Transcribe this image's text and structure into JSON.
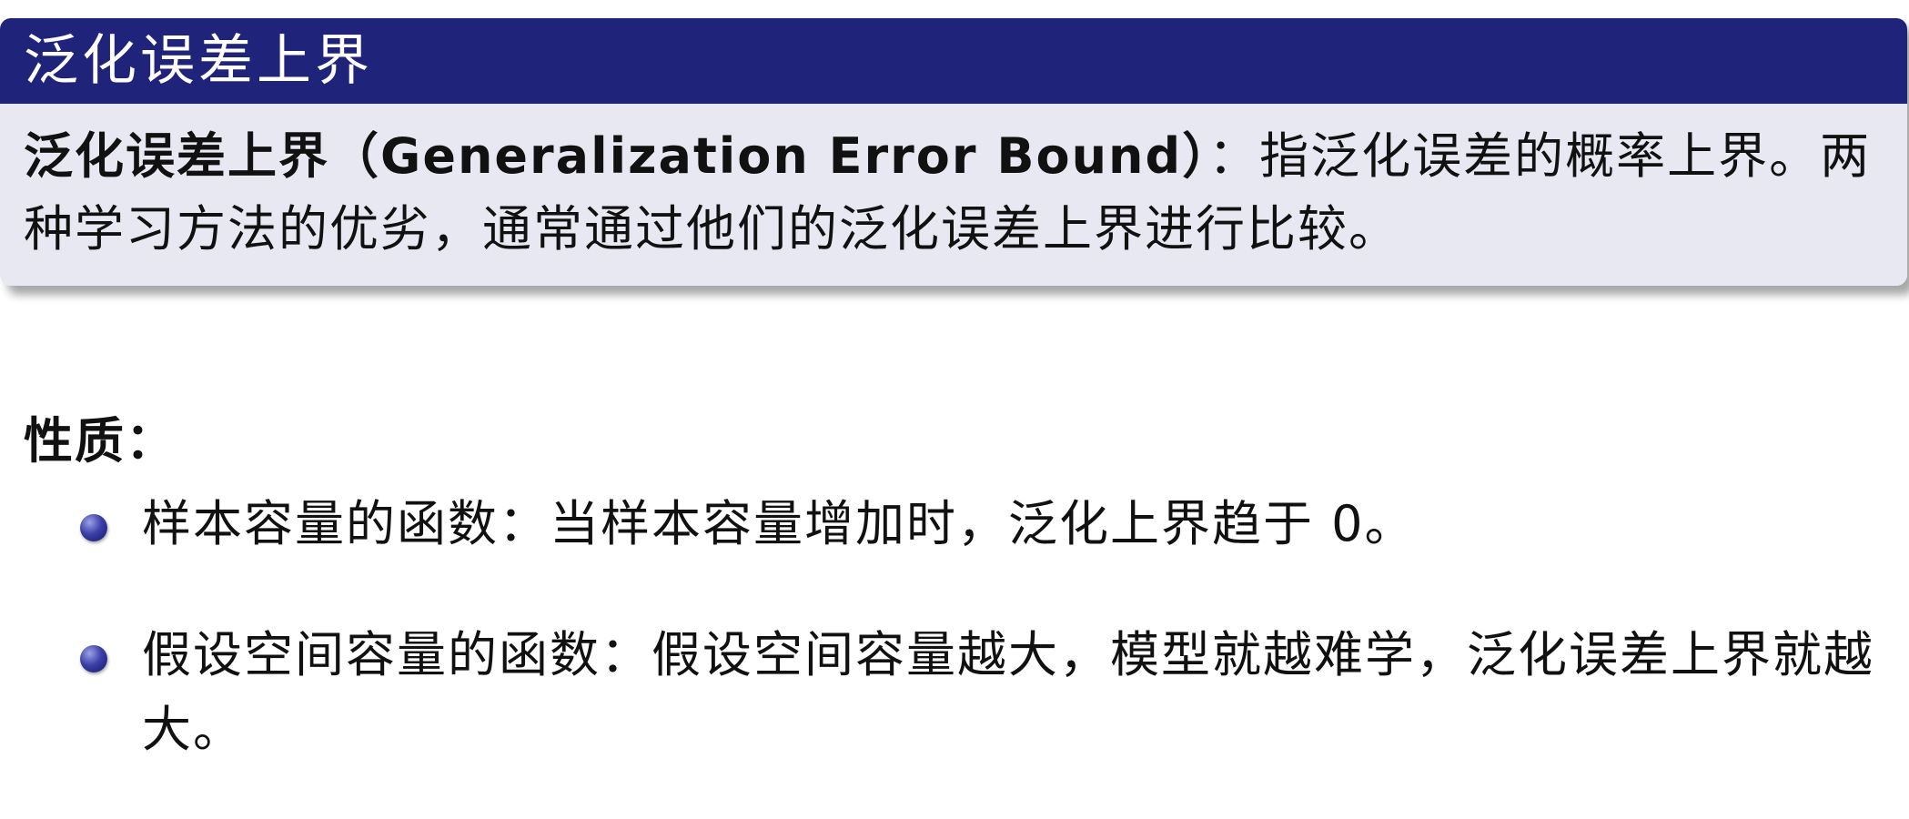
{
  "slide": {
    "block_title": "泛化误差上界",
    "definition": {
      "term": "泛化误差上界（Generalization Error Bound）",
      "text": "：指泛化误差的概率上界。两种学习方法的优劣，通常通过他们的泛化误差上界进行比较。"
    },
    "properties_heading": "性质：",
    "properties": [
      "样本容量的函数：当样本容量增加时，泛化上界趋于 0。",
      "假设空间容量的函数：假设空间容量越大，模型就越难学，泛化误差上界就越大。"
    ]
  }
}
